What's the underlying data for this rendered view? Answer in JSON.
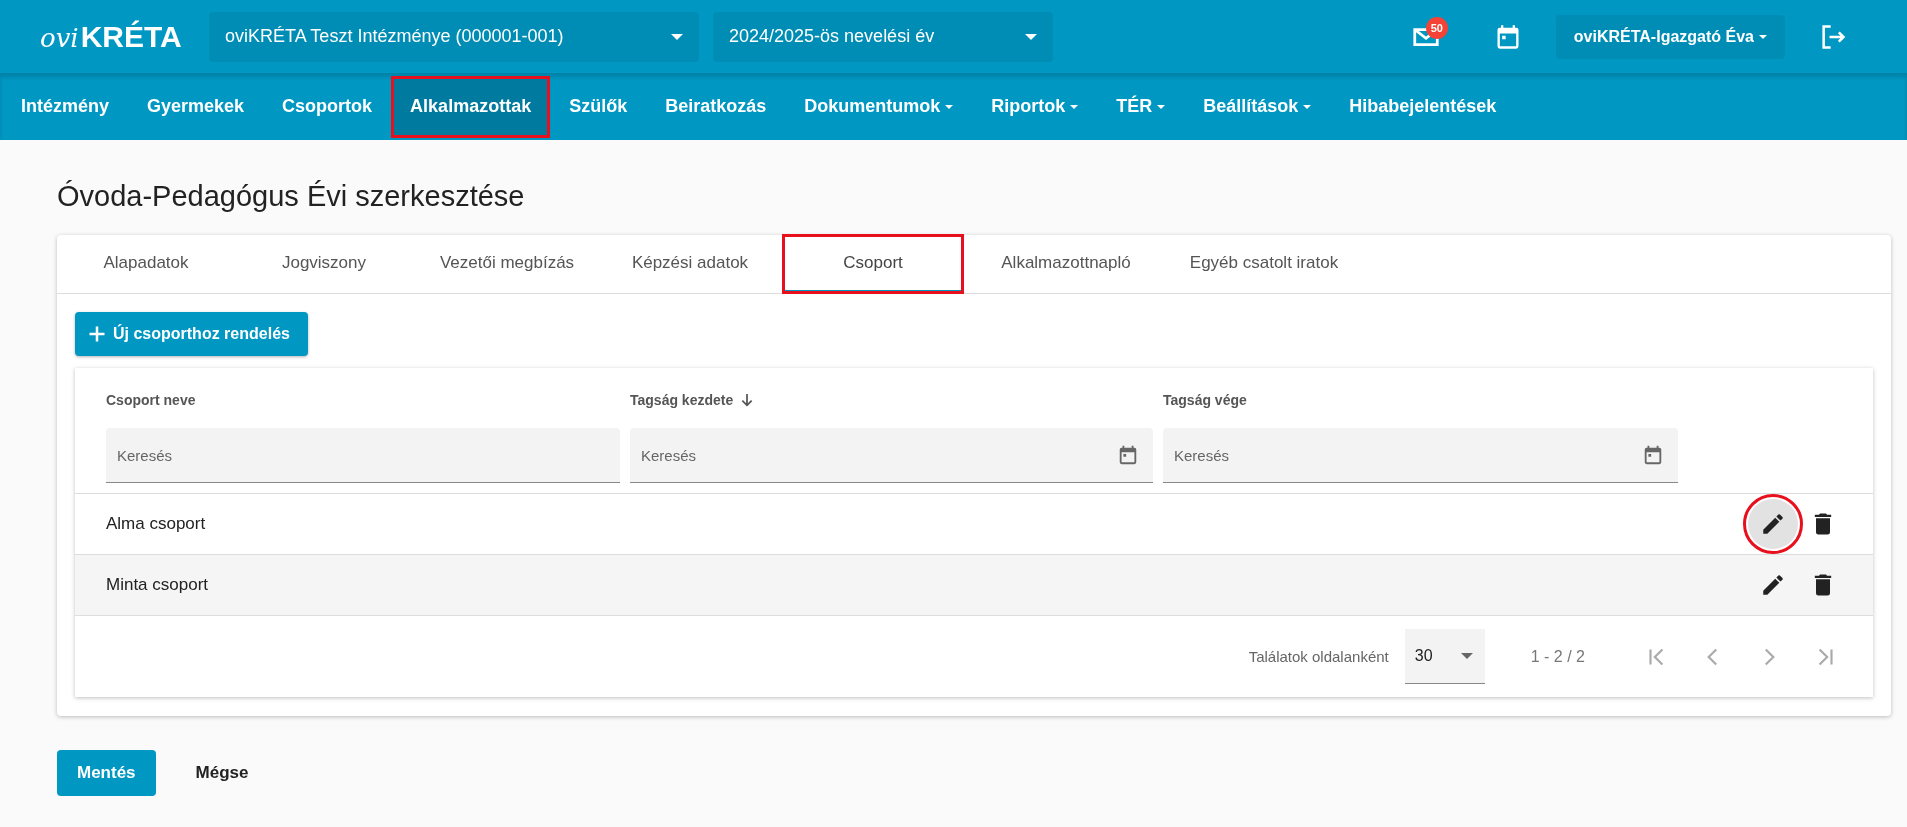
{
  "header": {
    "logo": {
      "prefix": "ovi",
      "name": "KRÉTA"
    },
    "institution_select": {
      "value": "oviKRÉTA Teszt Intézménye (000001-001)"
    },
    "year_select": {
      "value": "2024/2025-ös nevelési év"
    },
    "mail_badge": "50",
    "user_menu": "oviKRÉTA-Igazgató Éva"
  },
  "nav": [
    {
      "label": "Intézmény",
      "selected": false,
      "dropdown": false,
      "highlighted": false
    },
    {
      "label": "Gyermekek",
      "selected": false,
      "dropdown": false,
      "highlighted": false
    },
    {
      "label": "Csoportok",
      "selected": false,
      "dropdown": false,
      "highlighted": false
    },
    {
      "label": "Alkalmazottak",
      "selected": true,
      "dropdown": false,
      "highlighted": true
    },
    {
      "label": "Szülők",
      "selected": false,
      "dropdown": false,
      "highlighted": false
    },
    {
      "label": "Beiratkozás",
      "selected": false,
      "dropdown": false,
      "highlighted": false
    },
    {
      "label": "Dokumentumok",
      "selected": false,
      "dropdown": true,
      "highlighted": false
    },
    {
      "label": "Riportok",
      "selected": false,
      "dropdown": true,
      "highlighted": false
    },
    {
      "label": "TÉR",
      "selected": false,
      "dropdown": true,
      "highlighted": false
    },
    {
      "label": "Beállítások",
      "selected": false,
      "dropdown": true,
      "highlighted": false
    },
    {
      "label": "Hibabejelentések",
      "selected": false,
      "dropdown": false,
      "highlighted": false
    }
  ],
  "page_title": "Óvoda-Pedagógus Évi szerkesztése",
  "tabs": [
    {
      "label": "Alapadatok",
      "selected": false,
      "highlighted": false
    },
    {
      "label": "Jogviszony",
      "selected": false,
      "highlighted": false
    },
    {
      "label": "Vezetői megbízás",
      "selected": false,
      "highlighted": false
    },
    {
      "label": "Képzési adatok",
      "selected": false,
      "highlighted": false
    },
    {
      "label": "Csoport",
      "selected": true,
      "highlighted": true
    },
    {
      "label": "Alkalmazottnapló",
      "selected": false,
      "highlighted": false
    },
    {
      "label": "Egyéb csatolt iratok",
      "selected": false,
      "highlighted": false
    }
  ],
  "add_button": "Új csoporthoz rendelés",
  "table": {
    "columns": [
      {
        "label": "Csoport neve",
        "sorted": false,
        "placeholder": "Keresés",
        "date": false
      },
      {
        "label": "Tagság kezdete",
        "sorted": true,
        "placeholder": "Keresés",
        "date": true
      },
      {
        "label": "Tagság vége",
        "sorted": false,
        "placeholder": "Keresés",
        "date": true
      }
    ],
    "rows": [
      {
        "name": "Alma csoport",
        "hovered": true,
        "highlighted": true
      },
      {
        "name": "Minta csoport",
        "hovered": false,
        "highlighted": false
      }
    ],
    "pagination": {
      "label": "Találatok oldalanként",
      "page_size": "30",
      "range": "1 - 2 / 2"
    }
  },
  "footer_buttons": [
    {
      "label": "Mentés",
      "kind": "primary"
    },
    {
      "label": "Mégse",
      "kind": "text"
    }
  ]
}
